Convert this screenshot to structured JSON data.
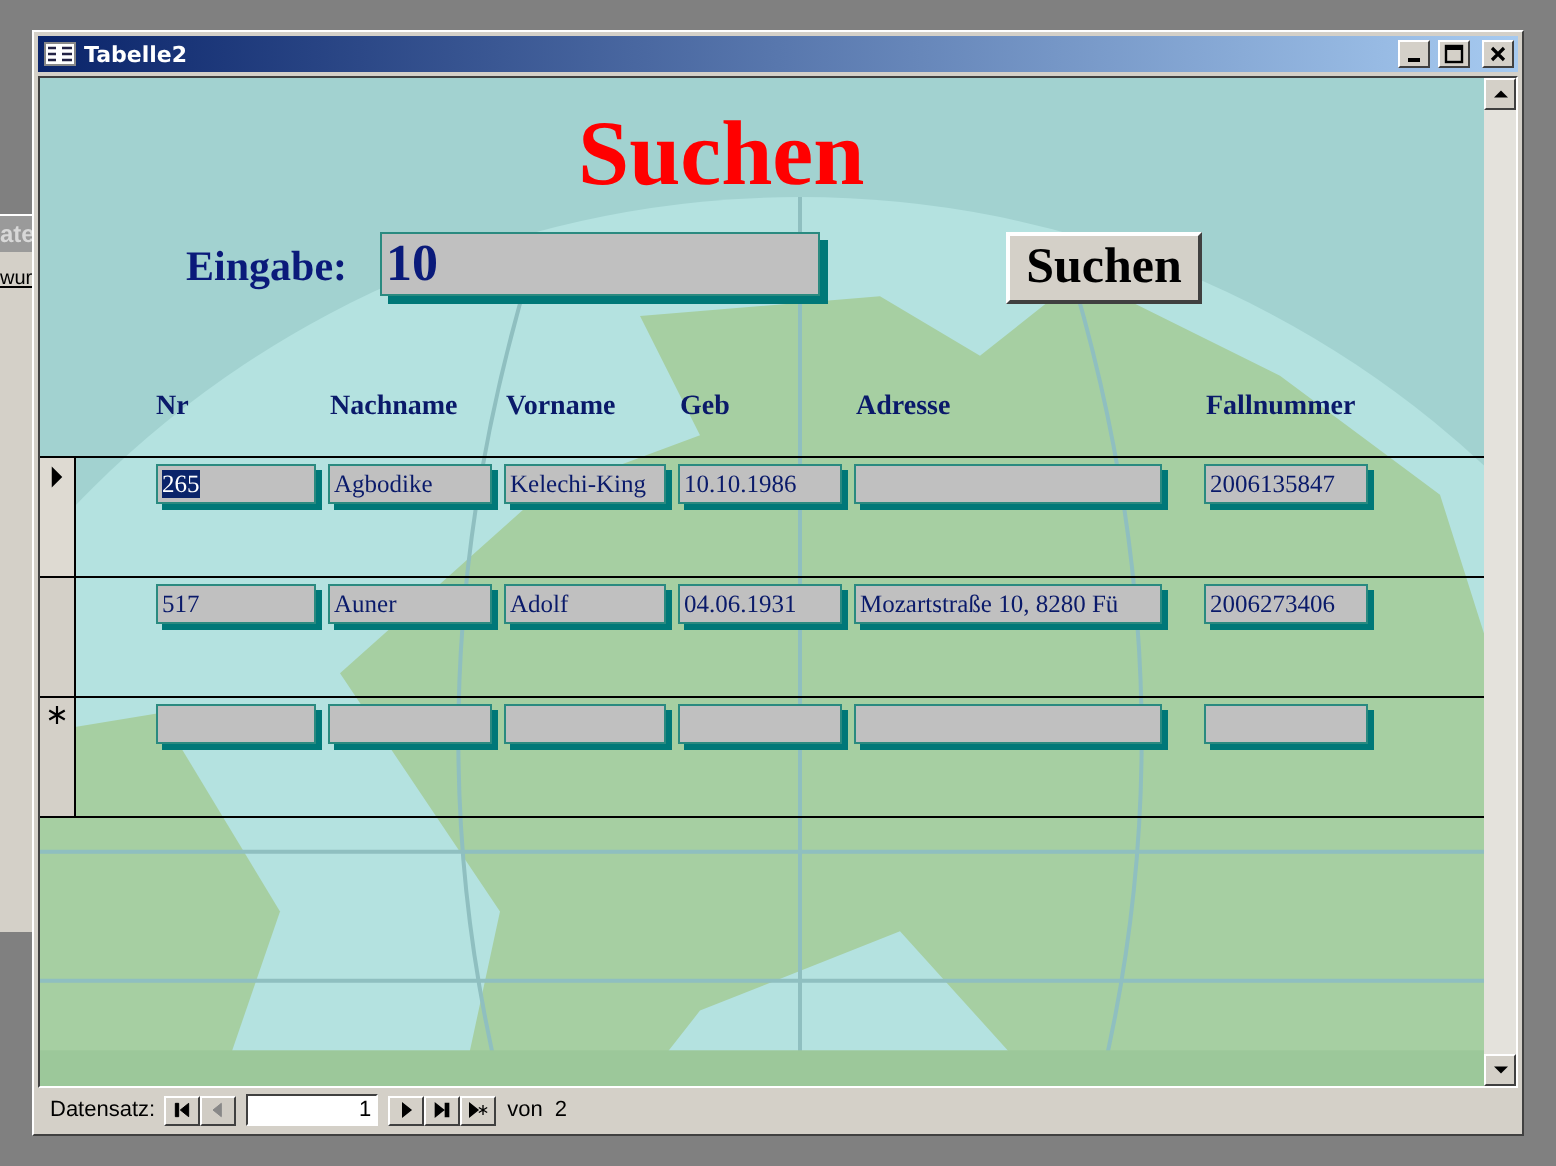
{
  "behind_window": {
    "title": "ate",
    "item": "wur"
  },
  "window": {
    "title": "Tabelle2"
  },
  "form": {
    "heading": "Suchen",
    "input_label": "Eingabe:",
    "input_value": "10",
    "search_button": "Suchen"
  },
  "columns": [
    "Nr",
    "Nachname",
    "Vorname",
    "Geb",
    "Adresse",
    "Fallnummer"
  ],
  "rows": [
    {
      "kind": "record",
      "selected": true,
      "cells": [
        "265",
        "Agbodike",
        "Kelechi-King",
        "10.10.1986",
        "",
        "2006135847"
      ]
    },
    {
      "kind": "record",
      "selected": false,
      "cells": [
        "517",
        "Auner",
        "Adolf",
        "04.06.1931",
        "Mozartstraße 10, 8280 Fü",
        "2006273406"
      ]
    },
    {
      "kind": "new",
      "selected": false,
      "cells": [
        "",
        "",
        "",
        "",
        "",
        ""
      ]
    }
  ],
  "navigation": {
    "label": "Datensatz:",
    "record": "1",
    "count_label": "von",
    "total": "2",
    "buttons": [
      {
        "kind": "first",
        "disabled": false
      },
      {
        "kind": "prev",
        "disabled": true
      }
    ],
    "buttons_after": [
      {
        "kind": "next",
        "disabled": false
      },
      {
        "kind": "last",
        "disabled": false
      },
      {
        "kind": "new",
        "disabled": false
      }
    ]
  }
}
